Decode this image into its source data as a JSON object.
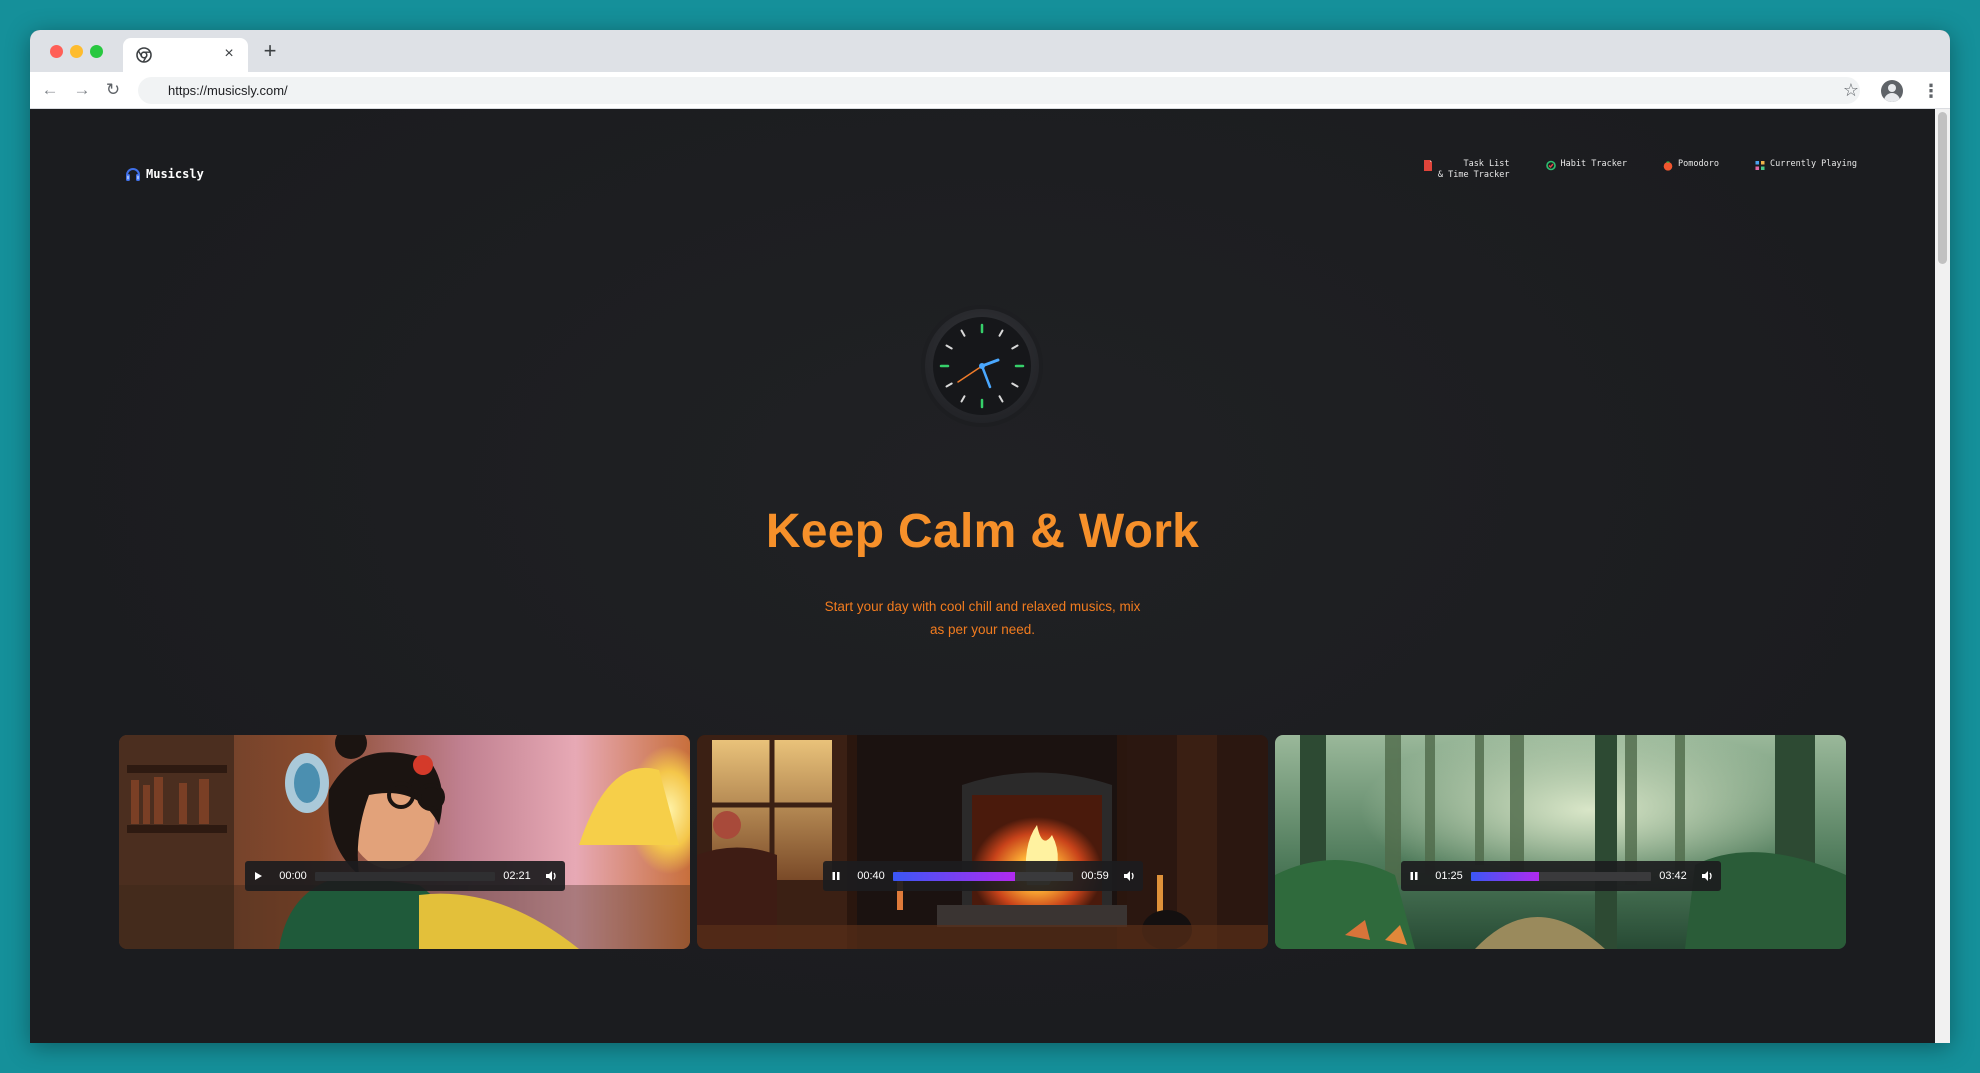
{
  "browser": {
    "tab_close": "×",
    "new_tab": "+",
    "url": "https://musicsly.com/",
    "back": "←",
    "forward": "→",
    "reload": "↻",
    "star": "☆",
    "menu": "⋮"
  },
  "site": {
    "brand_name": "Musicsly",
    "nav": [
      {
        "label": "Task List\n& Time Tracker",
        "icon": "document-icon",
        "color": "#e0443a"
      },
      {
        "label": "Habit Tracker",
        "icon": "habit-icon",
        "color": "#2fbf71"
      },
      {
        "label": "Pomodoro",
        "icon": "tomato-icon",
        "color": "#f0562e"
      },
      {
        "label": "Currently Playing",
        "icon": "playlist-icon",
        "color": "#4aa3f0"
      }
    ]
  },
  "hero": {
    "title": "Keep Calm & Work",
    "subtitle": "Start your day with cool chill and relaxed musics, mix as per your need."
  },
  "cards": [
    {
      "scene": "girl-with-headphones",
      "state": "paused",
      "current": "00:00",
      "duration": "02:21",
      "progress": 0.0
    },
    {
      "scene": "fireplace",
      "state": "playing",
      "current": "00:40",
      "duration": "00:59",
      "progress": 0.68
    },
    {
      "scene": "forest",
      "state": "playing",
      "current": "01:25",
      "duration": "03:42",
      "progress": 0.38
    }
  ],
  "colors": {
    "accent_title": "#f6902a",
    "accent_sub": "#f27c1f",
    "progress_start": "#3a57f5",
    "progress_end": "#b12af0"
  }
}
